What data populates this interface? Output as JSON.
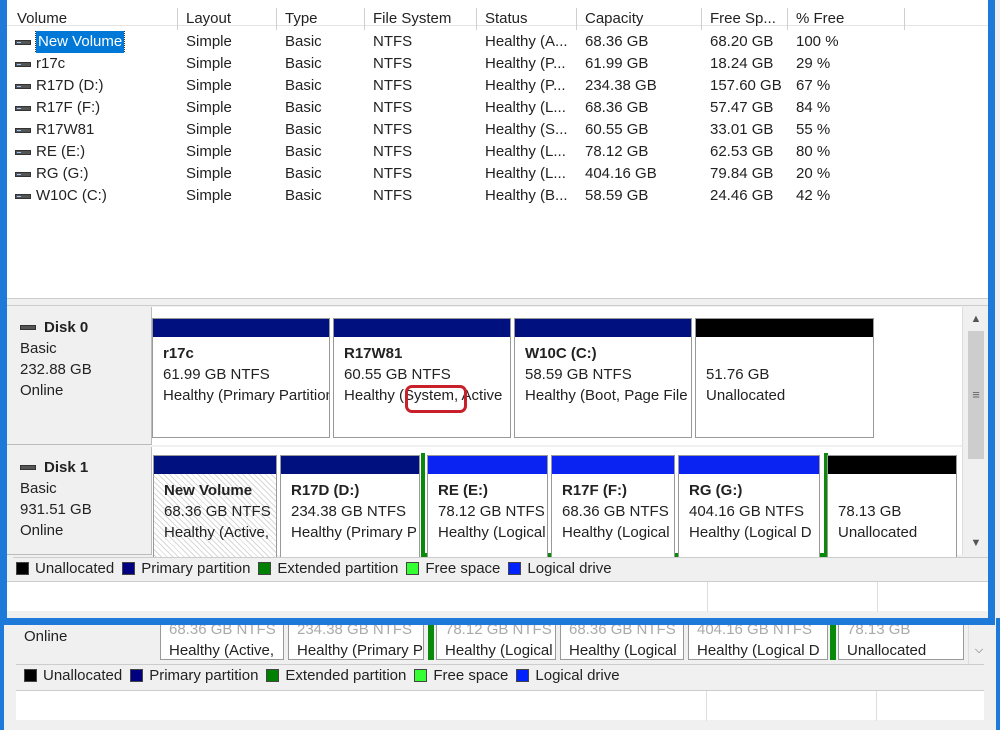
{
  "columns": [
    "Volume",
    "Layout",
    "Type",
    "File System",
    "Status",
    "Capacity",
    "Free Sp...",
    "% Free"
  ],
  "volumes": [
    {
      "name": "New Volume",
      "layout": "Simple",
      "type": "Basic",
      "fs": "NTFS",
      "status": "Healthy (A...",
      "capacity": "68.36 GB",
      "free": "68.20 GB",
      "pct": "100 %"
    },
    {
      "name": "r17c",
      "layout": "Simple",
      "type": "Basic",
      "fs": "NTFS",
      "status": "Healthy (P...",
      "capacity": "61.99 GB",
      "free": "18.24 GB",
      "pct": "29 %"
    },
    {
      "name": "R17D (D:)",
      "layout": "Simple",
      "type": "Basic",
      "fs": "NTFS",
      "status": "Healthy (P...",
      "capacity": "234.38 GB",
      "free": "157.60 GB",
      "pct": "67 %"
    },
    {
      "name": "R17F (F:)",
      "layout": "Simple",
      "type": "Basic",
      "fs": "NTFS",
      "status": "Healthy (L...",
      "capacity": "68.36 GB",
      "free": "57.47 GB",
      "pct": "84 %"
    },
    {
      "name": "R17W81",
      "layout": "Simple",
      "type": "Basic",
      "fs": "NTFS",
      "status": "Healthy (S...",
      "capacity": "60.55 GB",
      "free": "33.01 GB",
      "pct": "55 %"
    },
    {
      "name": "RE (E:)",
      "layout": "Simple",
      "type": "Basic",
      "fs": "NTFS",
      "status": "Healthy (L...",
      "capacity": "78.12 GB",
      "free": "62.53 GB",
      "pct": "80 %"
    },
    {
      "name": "RG (G:)",
      "layout": "Simple",
      "type": "Basic",
      "fs": "NTFS",
      "status": "Healthy (L...",
      "capacity": "404.16 GB",
      "free": "79.84 GB",
      "pct": "20 %"
    },
    {
      "name": "W10C (C:)",
      "layout": "Simple",
      "type": "Basic",
      "fs": "NTFS",
      "status": "Healthy (B...",
      "capacity": "58.59 GB",
      "free": "24.46 GB",
      "pct": "42 %"
    }
  ],
  "disk0": {
    "title": "Disk 0",
    "type": "Basic",
    "size": "232.88 GB",
    "state": "Online",
    "partitions": [
      {
        "name": "r17c",
        "size": "61.99 GB NTFS",
        "status": "Healthy (Primary Partition)"
      },
      {
        "name": "R17W81",
        "size": "60.55 GB NTFS",
        "status": "Healthy (System, Active"
      },
      {
        "name": "W10C  (C:)",
        "size": "58.59 GB NTFS",
        "status": "Healthy (Boot, Page File"
      },
      {
        "name": "",
        "size": "51.76 GB",
        "status": "Unallocated"
      }
    ]
  },
  "disk1": {
    "title": "Disk 1",
    "type": "Basic",
    "size": "931.51 GB",
    "state": "Online",
    "partitions": [
      {
        "name": "New Volume",
        "size": "68.36 GB NTFS",
        "status": "Healthy (Active,"
      },
      {
        "name": "R17D  (D:)",
        "size": "234.38 GB NTFS",
        "status": "Healthy (Primary P"
      },
      {
        "name": "RE  (E:)",
        "size": "78.12 GB NTFS",
        "status": "Healthy (Logical"
      },
      {
        "name": "R17F  (F:)",
        "size": "68.36 GB NTFS",
        "status": "Healthy (Logical"
      },
      {
        "name": "RG  (G:)",
        "size": "404.16 GB NTFS",
        "status": "Healthy (Logical D"
      },
      {
        "name": "",
        "size": "78.13 GB",
        "status": "Unallocated"
      }
    ]
  },
  "legend": [
    {
      "label": "Unallocated",
      "color": "#000000"
    },
    {
      "label": "Primary partition",
      "color": "#000080"
    },
    {
      "label": "Extended partition",
      "color": "#008000"
    },
    {
      "label": "Free space",
      "color": "#33ff33"
    },
    {
      "label": "Logical drive",
      "color": "#0022ff"
    }
  ],
  "colors": {
    "primary_bar": "#00117f",
    "logical_bar": "#0a23f2",
    "unallocated_bar": "#000000",
    "extended_frame": "#0a8a0a",
    "window_border": "#1e7ad9",
    "annotation": "#c8202a"
  },
  "bg_window": {
    "disk_state": "Online",
    "status_fragments": [
      "Healthy (Active,",
      "Healthy (Primary P",
      "Healthy (Logical",
      "Healthy (Logical",
      "Healthy (Logical D",
      "Unallocated"
    ],
    "ghost_fragments": [
      "68.36 GB NTFS",
      "234.38 GB NTFS",
      "78.12 GB NTFS",
      "68.36 GB NTFS",
      "404.16 GB NTFS",
      "78.13 GB"
    ]
  }
}
